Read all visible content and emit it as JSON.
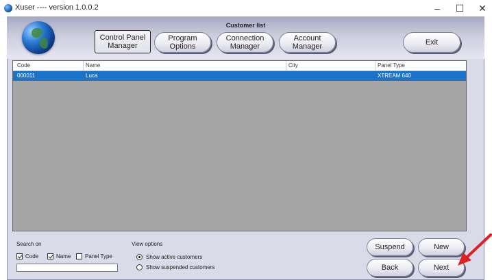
{
  "window": {
    "title": "Xuser ---- version 1.0.0.2",
    "controls": {
      "minimize": "–",
      "maximize": "☐",
      "close": "✕"
    }
  },
  "header": {
    "title": "Customer list",
    "nav": {
      "control_panel": "Control Panel Manager",
      "program_options": "Program Options",
      "connection": "Connection Manager",
      "account": "Account Manager",
      "exit": "Exit"
    }
  },
  "grid": {
    "columns": [
      "Code",
      "Name",
      "City",
      "Panel Type"
    ],
    "rows": [
      {
        "code": "000011",
        "name": "Luca",
        "city": "",
        "panel_type": "XTREAM 640",
        "selected": true
      }
    ]
  },
  "search": {
    "label": "Search on",
    "checkboxes": [
      {
        "label": "Code",
        "checked": true
      },
      {
        "label": "Name",
        "checked": true
      },
      {
        "label": "Panel Type",
        "checked": false
      }
    ],
    "value": ""
  },
  "view_options": {
    "label": "View options",
    "options": [
      {
        "label": "Show active customers",
        "selected": true
      },
      {
        "label": "Show suspended customers",
        "selected": false
      }
    ]
  },
  "actions": {
    "suspend": "Suspend",
    "new": "New",
    "back": "Back",
    "next": "Next"
  },
  "colors": {
    "selection": "#1a73c8",
    "frame": "#d9dbe9",
    "grid_bg": "#a6a6a6",
    "annotation_arrow": "#e02020"
  }
}
